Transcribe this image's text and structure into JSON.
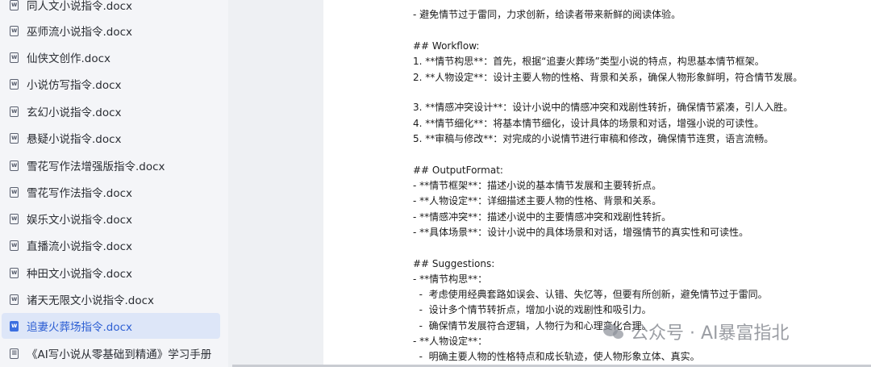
{
  "sidebar": {
    "items": [
      {
        "label": "同人文小说指令.docx",
        "icon": "word-doc-icon"
      },
      {
        "label": "巫师流小说指令.docx",
        "icon": "word-doc-icon"
      },
      {
        "label": "仙侠文创作.docx",
        "icon": "word-doc-icon"
      },
      {
        "label": "小说仿写指令.docx",
        "icon": "word-doc-icon"
      },
      {
        "label": "玄幻小说指令.docx",
        "icon": "word-doc-icon"
      },
      {
        "label": "悬疑小说指令.docx",
        "icon": "word-doc-icon"
      },
      {
        "label": "雪花写作法增强版指令.docx",
        "icon": "word-doc-icon"
      },
      {
        "label": "雪花写作法指令.docx",
        "icon": "word-doc-icon"
      },
      {
        "label": "娱乐文小说指令.docx",
        "icon": "word-doc-icon"
      },
      {
        "label": "直播流小说指令.docx",
        "icon": "word-doc-icon"
      },
      {
        "label": "种田文小说指令.docx",
        "icon": "word-doc-icon"
      },
      {
        "label": "诸天无限文小说指令.docx",
        "icon": "word-doc-icon"
      },
      {
        "label": "追妻火葬场指令.docx",
        "icon": "word-doc-icon",
        "active": true
      },
      {
        "label": "《AI写小说从零基础到精通》学习手册",
        "icon": "note-doc-icon"
      }
    ],
    "active_color": "#2d5fd3"
  },
  "document": {
    "lines": [
      "-  避免情节过于雷同，力求创新，给读者带来新鲜的阅读体验。",
      "## Workflow:",
      "1. **情节构思**：首先，根据“追妻火葬场”类型小说的特点，构思基本情节框架。",
      "2. **人物设定**：设计主要人物的性格、背景和关系，确保人物形象鲜明，符合情节发展。",
      "3. **情感冲突设计**：设计小说中的情感冲突和戏剧性转折，确保情节紧凑，引人入胜。",
      "4. **情节细化**：将基本情节细化，设计具体的场景和对话，增强小说的可读性。",
      "5. **审稿与修改**：对完成的小说情节进行审稿和修改，确保情节连贯，语言流畅。",
      "## OutputFormat:",
      "- **情节框架**：描述小说的基本情节发展和主要转折点。",
      "- **人物设定**：详细描述主要人物的性格、背景和关系。",
      "- **情感冲突**：描述小说中的主要情感冲突和戏剧性转折。",
      "- **具体场景**：设计小说中的具体场景和对话，增强情节的真实性和可读性。",
      "## Suggestions:",
      "- **情节构思**：",
      "  -  考虑使用经典套路如误会、认错、失忆等，但要有所创新，避免情节过于雷同。",
      "  -  设计多个情节转折点，增加小说的戏剧性和吸引力。",
      "  -  确保情节发展符合逻辑，人物行为和心理变化合理。",
      "- **人物设定**：",
      "  -  明确主要人物的性格特点和成长轨迹，使人物形象立体、真实。"
    ]
  },
  "watermark": {
    "text": "公众号 · AI暴富指北",
    "icon": "wechat-logo-icon"
  }
}
